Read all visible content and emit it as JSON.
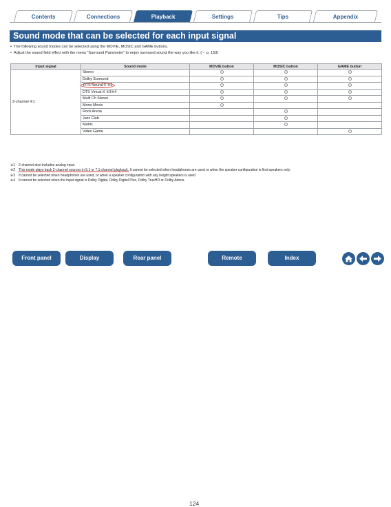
{
  "tabs": [
    {
      "label": "Contents"
    },
    {
      "label": "Connections"
    },
    {
      "label": "Playback"
    },
    {
      "label": "Settings"
    },
    {
      "label": "Tips"
    },
    {
      "label": "Appendix"
    }
  ],
  "title": "Sound mode that can be selected for each input signal",
  "bullets": [
    "The following sound modes can be selected using the MOVIE, MUSIC and GAME buttons.",
    "Adjust the sound field effect with the menu “Surround Parameter” to enjoy surround sound the way you like it.  (☞ p. 153)"
  ],
  "table": {
    "headers": [
      "Input signal",
      "Sound mode",
      "MOVIE button",
      "MUSIC button",
      "GAME button"
    ],
    "input_signal": "2-channel ※1",
    "rows": [
      {
        "mode": "Stereo",
        "movie": true,
        "music": true,
        "game": true
      },
      {
        "mode": "Dolby Surround",
        "movie": true,
        "music": true,
        "game": true
      },
      {
        "mode": "DTS Neural:X ※2",
        "movie": true,
        "music": true,
        "game": true
      },
      {
        "mode": "DTS Virtual:X ※3※4",
        "movie": true,
        "music": true,
        "game": true
      },
      {
        "mode": "Multi Ch Stereo",
        "movie": true,
        "music": true,
        "game": true
      },
      {
        "mode": "Mono Movie",
        "movie": true,
        "music": false,
        "game": false
      },
      {
        "mode": "Rock Arena",
        "movie": false,
        "music": true,
        "game": false
      },
      {
        "mode": "Jazz Club",
        "movie": false,
        "music": true,
        "game": false
      },
      {
        "mode": "Matrix",
        "movie": false,
        "music": true,
        "game": false
      },
      {
        "mode": "Video Game",
        "movie": false,
        "music": false,
        "game": true
      }
    ]
  },
  "notes": [
    {
      "key": "※1",
      "text": "2-channel also includes analog input."
    },
    {
      "key": "※2",
      "text_ul": "This mode plays back 2-channel sources in 5.1 or 7.1-channel playback.",
      "text": " It cannot be selected when headphones are used or when the speaker configuration is first speakers only."
    },
    {
      "key": "※3",
      "text": "It cannot be selected when headphones are used, or when a speaker configuration with any height speakers is used."
    },
    {
      "key": "※4",
      "text": "It cannot be selected when the input signal is Dolby Digital, Dolby Digital Plus, Dolby TrueHD or Dolby Atmos."
    }
  ],
  "footer": {
    "buttons": [
      "Front panel",
      "Display",
      "Rear panel",
      "Remote",
      "Index"
    ],
    "page_number": "124"
  },
  "colors": {
    "accent": "#2c5d93",
    "highlight": "#d2352c"
  }
}
